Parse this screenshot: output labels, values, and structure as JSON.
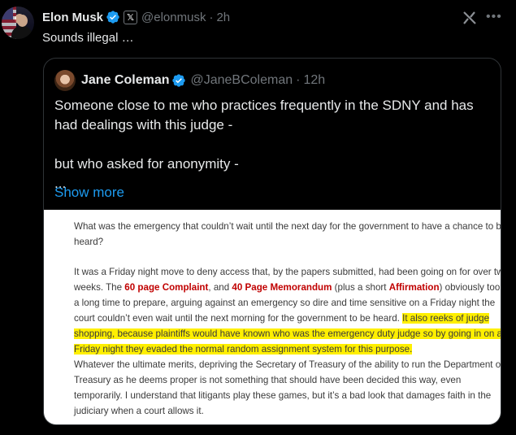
{
  "post": {
    "author_name": "Elon Musk",
    "author_handle": "@elonmusk",
    "separator": "·",
    "time": "2h",
    "text": "Sounds illegal …"
  },
  "quote": {
    "author_name": "Jane Coleman",
    "author_handle": "@JaneBColeman",
    "separator": "·",
    "time": "12h",
    "line1": "Someone close to me who practices frequently in the SDNY and has",
    "line2": "had dealings with this judge -",
    "line3": "but who asked for anonymity -",
    "line4": "...",
    "show_more": "Show more"
  },
  "document": {
    "p1_l1": "What was the emergency that couldn’t wait until the next day for the government to have a chance to be",
    "p1_l2": "heard?",
    "p2_l1": "It was a Friday night move to deny access that, by the papers submitted, had been going on for over two",
    "p2_l2a": "weeks. The ",
    "p2_l2b": "60 page Complaint",
    "p2_l2c": ", and ",
    "p2_l2d": "40 Page Memorandum",
    "p2_l2e": " (plus a short ",
    "p2_l2f": "Affirmation",
    "p2_l2g": ") obviously took",
    "p2_l3": "a long time to prepare, arguing against an emergency so dire and time sensitive on a Friday night the",
    "p2_l4a": "court couldn’t even wait until the next morning for the government to be heard. ",
    "p2_l4b": "It also reeks of judge",
    "p2_l5": "shopping, because plaintiffs would have known who was the emergency duty judge so by going in on a",
    "p2_l6": "Friday night they evaded the normal random assignment system for this purpose.",
    "p3_l1": "Whatever the ultimate merits, depriving the Secretary of Treasury of the ability to run the Department of",
    "p3_l2": "Treasury as he deems proper is not something that should have been decided this way, even",
    "p3_l3": "temporarily. I understand that litigants play these games, but it’s a bad look that damages faith in the",
    "p3_l4": "judiciary when a court allows it."
  },
  "icons": {
    "verified": "verified-badge-icon",
    "x_badge": "x-affiliate-icon",
    "grok": "grok-icon",
    "more": "more-options-icon"
  },
  "colors": {
    "background": "#000000",
    "text": "#e7e9ea",
    "muted": "#71767b",
    "link": "#1d9bf0",
    "verified": "#1d9bf0",
    "doc_red": "#c00000",
    "highlight": "#ffef00"
  }
}
